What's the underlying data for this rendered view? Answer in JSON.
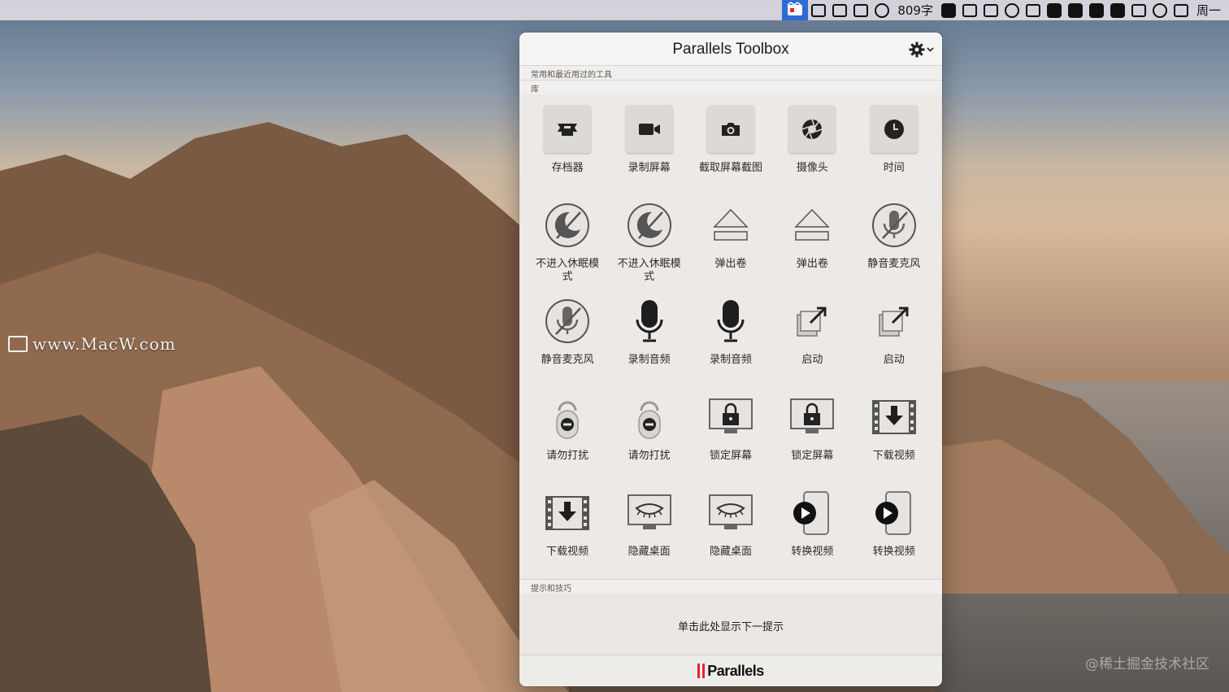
{
  "menubar": {
    "items": [
      {
        "name": "parallels-toolbox-menu-icon",
        "kind": "active"
      },
      {
        "name": "video-camera-menu-icon",
        "kind": "glyph"
      },
      {
        "name": "hand-menu-icon",
        "kind": "glyph"
      },
      {
        "name": "send-menu-icon",
        "kind": "glyph"
      },
      {
        "name": "onepassword-menu-icon",
        "kind": "round"
      },
      {
        "name": "word-count-menu-item",
        "kind": "text",
        "text": "809字"
      },
      {
        "name": "v-app-menu-icon",
        "kind": "fill"
      },
      {
        "name": "p-app-menu-icon",
        "kind": "glyph"
      },
      {
        "name": "s-app-menu-icon",
        "kind": "glyph"
      },
      {
        "name": "wechat-menu-icon",
        "kind": "round"
      },
      {
        "name": "window-menu-icon",
        "kind": "glyph"
      },
      {
        "name": "face-menu-icon",
        "kind": "fill"
      },
      {
        "name": "microphone-menu-icon",
        "kind": "fill"
      },
      {
        "name": "grid-menu-icon",
        "kind": "fill"
      },
      {
        "name": "sync-menu-icon",
        "kind": "fill"
      },
      {
        "name": "wifi-menu-icon",
        "kind": "glyph"
      },
      {
        "name": "time-machine-menu-icon",
        "kind": "round"
      },
      {
        "name": "bluetooth-menu-icon",
        "kind": "glyph"
      },
      {
        "name": "clock-menu-item",
        "kind": "text",
        "text": "周一"
      }
    ]
  },
  "panel": {
    "title": "Parallels Toolbox",
    "section_recent": "常用和最近用过的工具",
    "section_library": "库",
    "section_tips": "提示和技巧",
    "tip_text": "单击此处显示下一提示",
    "brand": "Parallels",
    "tools": [
      {
        "label": "存档器",
        "icon": "archive-icon",
        "tile": true
      },
      {
        "label": "录制屏幕",
        "icon": "video-camera-icon",
        "tile": true
      },
      {
        "label": "截取屏幕截图",
        "icon": "camera-icon",
        "tile": true
      },
      {
        "label": "摄像头",
        "icon": "aperture-icon",
        "tile": true
      },
      {
        "label": "时间",
        "icon": "clock-icon",
        "tile": true
      },
      {
        "label": "不进入休眠模式",
        "icon": "no-sleep-icon",
        "tile": false
      },
      {
        "label": "不进入休眠模式",
        "icon": "no-sleep-icon",
        "tile": false
      },
      {
        "label": "弹出卷",
        "icon": "eject-icon",
        "tile": false
      },
      {
        "label": "弹出卷",
        "icon": "eject-icon",
        "tile": false
      },
      {
        "label": "静音麦克风",
        "icon": "mute-mic-icon",
        "tile": false
      },
      {
        "label": "静音麦克风",
        "icon": "mute-mic-icon",
        "tile": false
      },
      {
        "label": "录制音频",
        "icon": "microphone-icon",
        "tile": false
      },
      {
        "label": "录制音频",
        "icon": "microphone-icon",
        "tile": false
      },
      {
        "label": "启动",
        "icon": "launch-icon",
        "tile": false
      },
      {
        "label": "启动",
        "icon": "launch-icon",
        "tile": false
      },
      {
        "label": "请勿打扰",
        "icon": "do-not-disturb-icon",
        "tile": false
      },
      {
        "label": "请勿打扰",
        "icon": "do-not-disturb-icon",
        "tile": false
      },
      {
        "label": "锁定屏幕",
        "icon": "lock-screen-icon",
        "tile": false
      },
      {
        "label": "锁定屏幕",
        "icon": "lock-screen-icon",
        "tile": false
      },
      {
        "label": "下载视频",
        "icon": "download-video-icon",
        "tile": false
      },
      {
        "label": "下载视频",
        "icon": "download-video-icon",
        "tile": false
      },
      {
        "label": "隐藏桌面",
        "icon": "hide-desktop-icon",
        "tile": false
      },
      {
        "label": "隐藏桌面",
        "icon": "hide-desktop-icon",
        "tile": false
      },
      {
        "label": "转换视频",
        "icon": "convert-video-icon",
        "tile": false
      },
      {
        "label": "转换视频",
        "icon": "convert-video-icon",
        "tile": false
      }
    ]
  },
  "desktop": {
    "watermark": "www.MacW.com",
    "credit": "@稀土掘金技术社区"
  }
}
